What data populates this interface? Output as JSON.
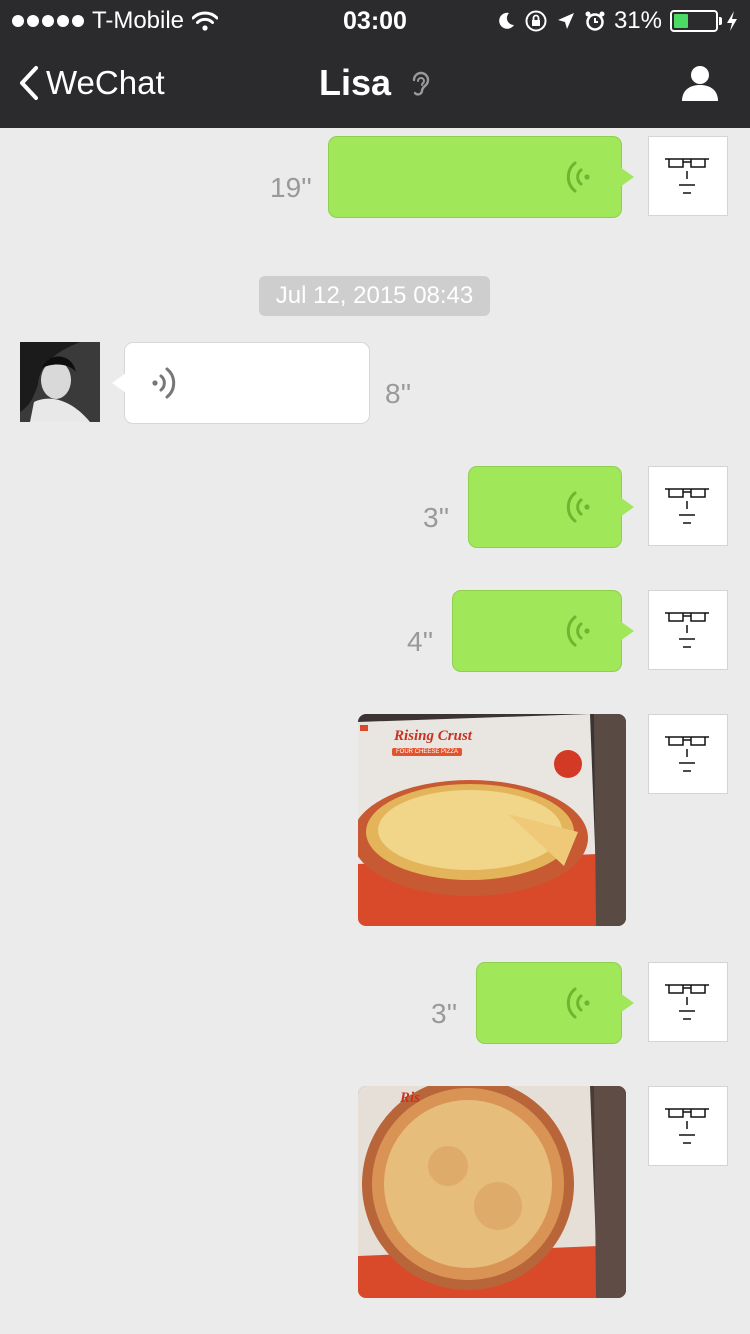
{
  "status_bar": {
    "carrier": "T-Mobile",
    "time": "03:00",
    "battery_text": "31%",
    "battery_level": 0.31
  },
  "nav": {
    "back_label": "WeChat",
    "title": "Lisa"
  },
  "timestamp": "Jul 12, 2015 08:43",
  "messages": [
    {
      "type": "voice",
      "sender": "self",
      "duration": "19''"
    },
    {
      "type": "voice",
      "sender": "Lisa",
      "duration": "8''"
    },
    {
      "type": "voice",
      "sender": "self",
      "duration": "3''"
    },
    {
      "type": "voice",
      "sender": "self",
      "duration": "4''"
    },
    {
      "type": "image",
      "sender": "self",
      "box_brand": "Rising Crust",
      "box_subtitle": "FOUR CHEESE PIZZA"
    },
    {
      "type": "voice",
      "sender": "self",
      "duration": "3''"
    },
    {
      "type": "image",
      "sender": "self",
      "box_brand": "Ris"
    }
  ],
  "colors": {
    "nav_background": "#2b2b2d",
    "chat_background": "#ebebeb",
    "sent_bubble": "#a0e75a",
    "received_bubble": "#ffffff",
    "battery_fill": "#4cd964"
  },
  "icons": {
    "back": "chevron-left-icon",
    "ear": "ear-icon",
    "profile": "person-icon",
    "voice": "voice-wave-icon"
  }
}
